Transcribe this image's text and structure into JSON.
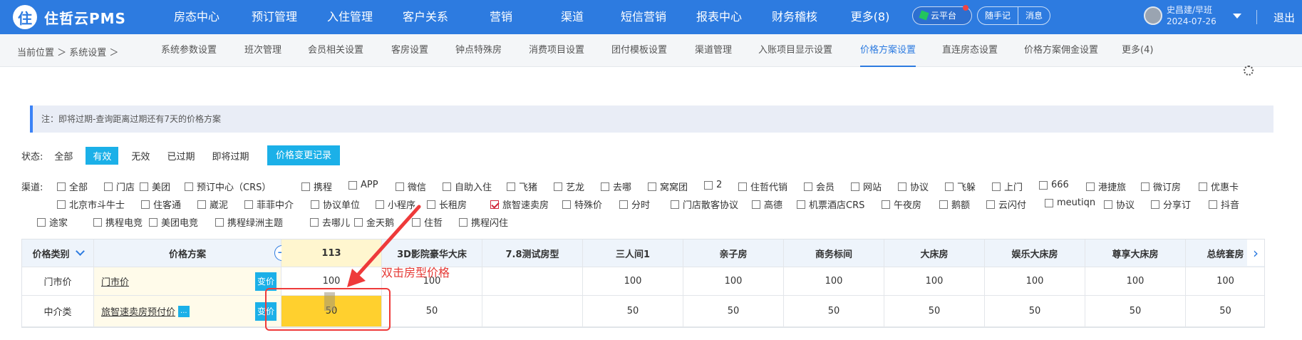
{
  "app": {
    "logo_mark": "住",
    "title": "住哲云PMS"
  },
  "topnav": {
    "items": [
      "房态中心",
      "预订管理",
      "入住管理",
      "客户关系",
      "营销",
      "渠道",
      "短信营销",
      "报表中心",
      "财务稽核",
      "更多(8)"
    ],
    "cloud_label": "云平台",
    "memo_label": "随手记",
    "message_label": "消息",
    "user_name": "史昌建/早班",
    "user_date": "2024-07-26",
    "logout_label": "退出"
  },
  "breadcrumb": "当前位置 ＞ 系统设置 ＞",
  "subtabs": [
    "系统参数设置",
    "班次管理",
    "会员相关设置",
    "客房设置",
    "钟点特殊房",
    "消费项目设置",
    "团付模板设置",
    "渠道管理",
    "入账项目显示设置",
    "价格方案设置",
    "直连房态设置",
    "价格方案佣金设置",
    "更多(4)"
  ],
  "subtab_active_index": 9,
  "notice": "注：即将过期-查询距离过期还有7天的价格方案",
  "status": {
    "label": "状态:",
    "options": [
      "全部",
      "有效",
      "无效",
      "已过期",
      "即将过期"
    ],
    "active_index": 1,
    "log_button": "价格变更记录"
  },
  "channels": {
    "label": "渠道:",
    "items": [
      {
        "label": "全部",
        "checked": false
      },
      {
        "label": "门店",
        "checked": false
      },
      {
        "label": "美团",
        "checked": false
      },
      {
        "label": "预订中心（CRS）",
        "checked": false
      },
      {
        "label": "携程",
        "checked": false
      },
      {
        "label": "APP",
        "checked": false
      },
      {
        "label": "微信",
        "checked": false
      },
      {
        "label": "自助入住",
        "checked": false
      },
      {
        "label": "飞猪",
        "checked": false
      },
      {
        "label": "艺龙",
        "checked": false
      },
      {
        "label": "去哪",
        "checked": false
      },
      {
        "label": "窝窝团",
        "checked": false
      },
      {
        "label": "2",
        "checked": false
      },
      {
        "label": "住哲代销",
        "checked": false
      },
      {
        "label": "会员",
        "checked": false
      },
      {
        "label": "网站",
        "checked": false
      },
      {
        "label": "协议",
        "checked": false
      },
      {
        "label": "飞躲",
        "checked": false
      },
      {
        "label": "上门",
        "checked": false
      },
      {
        "label": "666",
        "checked": false
      },
      {
        "label": "港捷旅",
        "checked": false
      },
      {
        "label": "微订房",
        "checked": false
      },
      {
        "label": "优惠卡",
        "checked": false
      },
      {
        "label": "北京市斗牛士",
        "checked": false
      },
      {
        "label": "住客通",
        "checked": false
      },
      {
        "label": "崴泥",
        "checked": false
      },
      {
        "label": "菲菲中介",
        "checked": false
      },
      {
        "label": "协议单位",
        "checked": false
      },
      {
        "label": "小程序",
        "checked": false
      },
      {
        "label": "长租房",
        "checked": false
      },
      {
        "label": "旅智速卖房",
        "checked": true
      },
      {
        "label": "特殊价",
        "checked": false
      },
      {
        "label": "分时",
        "checked": false
      },
      {
        "label": "门店散客协议",
        "checked": false
      },
      {
        "label": "高德",
        "checked": false
      },
      {
        "label": "机票酒店CRS",
        "checked": false
      },
      {
        "label": "午夜房",
        "checked": false
      },
      {
        "label": "鹅额",
        "checked": false
      },
      {
        "label": "云闪付",
        "checked": false
      },
      {
        "label": "meutiqn",
        "checked": false
      },
      {
        "label": "协议",
        "checked": false
      },
      {
        "label": "分享订",
        "checked": false
      },
      {
        "label": "抖音",
        "checked": false
      },
      {
        "label": "途家",
        "checked": false
      },
      {
        "label": "携程电竞",
        "checked": false
      },
      {
        "label": "美团电竞",
        "checked": false
      },
      {
        "label": "携程绿洲主题",
        "checked": false
      },
      {
        "label": "去哪儿",
        "checked": false
      },
      {
        "label": "金天鹅",
        "checked": false
      },
      {
        "label": "住哲",
        "checked": false
      },
      {
        "label": "携程闪住",
        "checked": false
      }
    ]
  },
  "table": {
    "col_category": "价格类别",
    "col_plan": "价格方案",
    "room_types": [
      "113",
      "3D影院豪华大床",
      "7.8测试房型",
      "三人间1",
      "亲子房",
      "商务标间",
      "大床房",
      "娱乐大床房",
      "尊享大床房",
      "总统套房"
    ],
    "rows": [
      {
        "category": "门市价",
        "plan": "门市价",
        "has_more": false,
        "change_label": "变价",
        "prices": [
          "100",
          "100",
          "",
          "100",
          "100",
          "100",
          "100",
          "100",
          "100",
          "100"
        ]
      },
      {
        "category": "中介类",
        "plan": "旅智速卖房预付价",
        "has_more": true,
        "more_label": "...",
        "change_label": "变价",
        "prices": [
          "50",
          "50",
          "",
          "50",
          "50",
          "50",
          "50",
          "50",
          "50",
          "50"
        ]
      }
    ],
    "add_label": "+",
    "next_label": "›"
  },
  "annotation": {
    "text": "双击房型价格",
    "color": "#e53935"
  },
  "colors": {
    "primary": "#2d7be0",
    "accent": "#1bb0e8",
    "highlight": "#ffd02e"
  }
}
